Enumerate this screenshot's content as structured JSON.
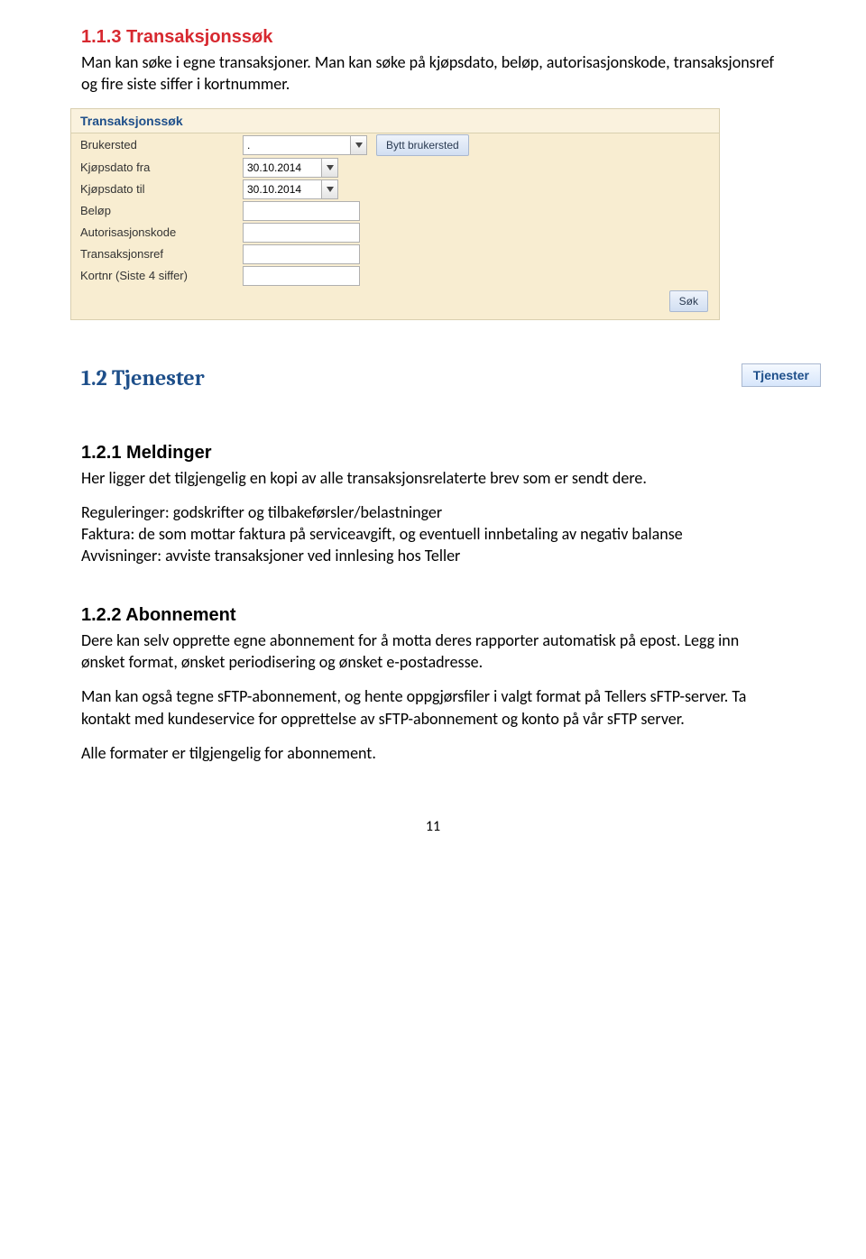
{
  "section113": {
    "heading": "1.1.3  Transaksjonssøk",
    "text": "Man kan søke i egne transaksjoner. Man kan søke på kjøpsdato, beløp,  autorisasjonskode, transaksjonsref og fire siste siffer i kortnummer."
  },
  "searchPanel": {
    "title": "Transaksjonssøk",
    "buttons": {
      "byttBrukersted": "Bytt brukersted",
      "sok": "Søk"
    },
    "rows": [
      {
        "label": "Brukersted",
        "value": ".",
        "type": "combo-wide",
        "hasBytt": true
      },
      {
        "label": "Kjøpsdato fra",
        "value": "30.10.2014",
        "type": "combo-date"
      },
      {
        "label": "Kjøpsdato til",
        "value": "30.10.2014",
        "type": "combo-date"
      },
      {
        "label": "Beløp",
        "value": "",
        "type": "std"
      },
      {
        "label": "Autorisasjonskode",
        "value": "",
        "type": "std"
      },
      {
        "label": "Transaksjonsref",
        "value": "",
        "type": "std"
      },
      {
        "label": "Kortnr (Siste 4 siffer)",
        "value": "",
        "type": "std"
      }
    ]
  },
  "section12": {
    "heading": "1.2  Tjenester",
    "tabLabel": "Tjenester"
  },
  "section121": {
    "heading": "1.2.1  Meldinger",
    "p1": "Her ligger det tilgjengelig en kopi av alle transaksjonsrelaterte brev som er sendt dere.",
    "p2": "Reguleringer: godskrifter og tilbakeførsler/belastninger",
    "p3": "Faktura: de som mottar faktura på serviceavgift, og eventuell innbetaling av negativ balanse",
    "p4": "Avvisninger: avviste transaksjoner ved innlesing hos Teller"
  },
  "section122": {
    "heading": "1.2.2  Abonnement",
    "p1": "Dere kan selv opprette egne abonnement for å motta deres rapporter automatisk på epost. Legg inn ønsket format, ønsket periodisering og ønsket e-postadresse.",
    "p2": "Man kan også tegne sFTP-abonnement, og hente oppgjørsfiler i valgt format på Tellers sFTP-server. Ta kontakt med kundeservice for opprettelse av sFTP-abonnement og konto på vår sFTP server.",
    "p3": "Alle formater er tilgjengelig for abonnement."
  },
  "pageNumber": "11"
}
